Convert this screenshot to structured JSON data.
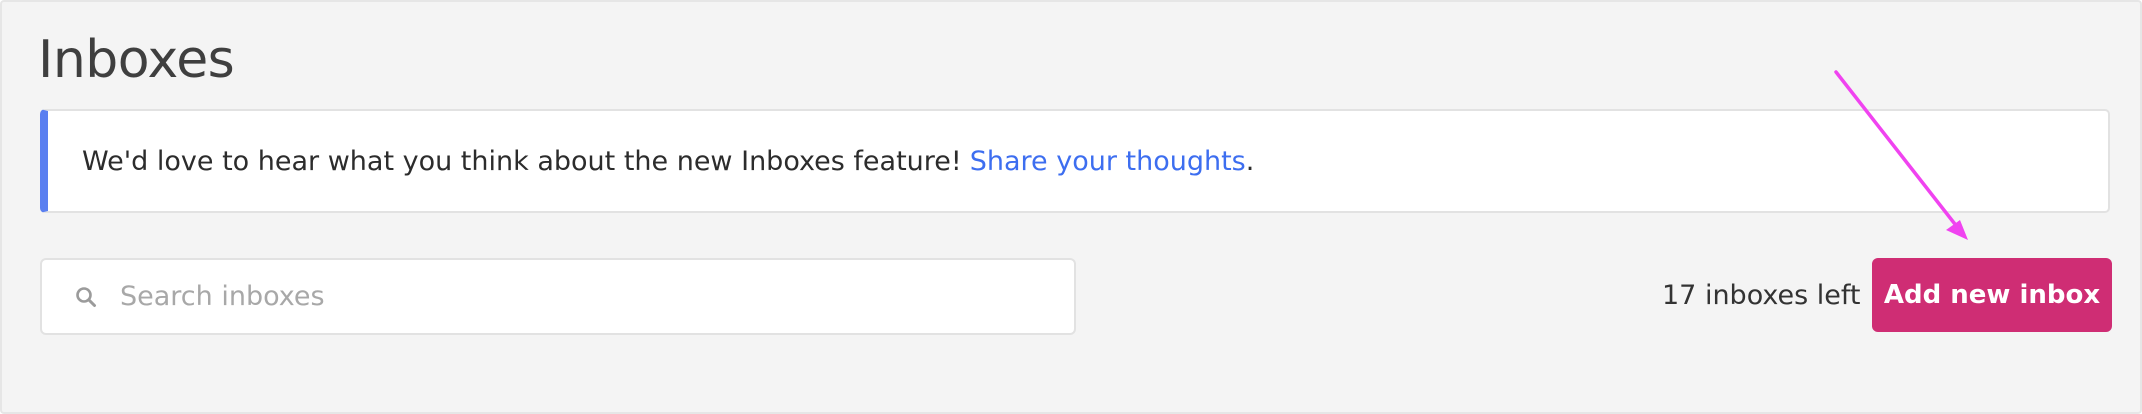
{
  "page": {
    "title": "Inboxes"
  },
  "banner": {
    "message": "We'd love to hear what you think about the new Inboxes feature!",
    "link_text": "Share your thoughts",
    "suffix": ".",
    "accent_color": "#5a7ff0",
    "link_color": "#3d6ef0"
  },
  "search": {
    "placeholder": "Search inboxes",
    "value": "",
    "icon": "search-icon"
  },
  "inbox_count": {
    "text": "17 inboxes left"
  },
  "add_button": {
    "label": "Add new inbox",
    "color": "#cf2d74"
  },
  "annotation": {
    "arrow_color": "#f043f0",
    "points_to": "add-new-inbox-button"
  }
}
